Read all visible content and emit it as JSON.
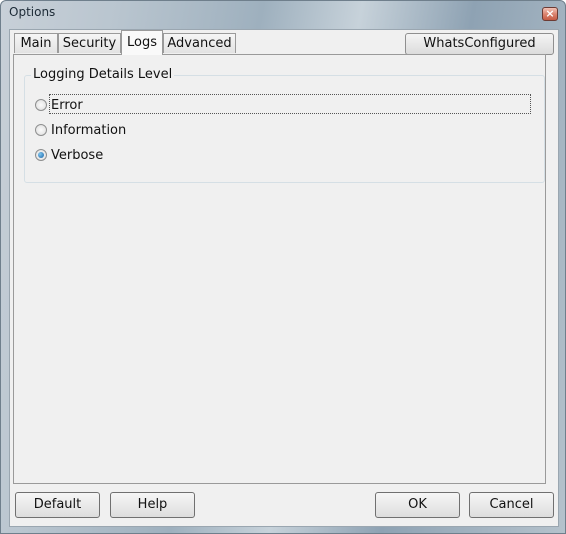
{
  "window": {
    "title": "Options",
    "close_icon": "×"
  },
  "tabs": [
    {
      "label": "Main",
      "active": false
    },
    {
      "label": "Security",
      "active": false
    },
    {
      "label": "Logs",
      "active": true
    },
    {
      "label": "Advanced",
      "active": false
    }
  ],
  "whats_configured_label": "WhatsConfigured",
  "logging": {
    "group_label": "Logging Details Level",
    "options": [
      {
        "label": "Error",
        "selected": false
      },
      {
        "label": "Information",
        "selected": false
      },
      {
        "label": "Verbose",
        "selected": true
      }
    ]
  },
  "buttons": {
    "default_label": "Default",
    "help_label": "Help",
    "ok_label": "OK",
    "cancel_label": "Cancel"
  }
}
